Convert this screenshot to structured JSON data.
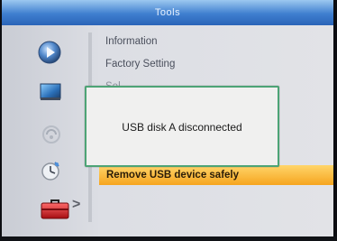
{
  "header": {
    "title": "Tools"
  },
  "menu": {
    "items": [
      {
        "label": "Information"
      },
      {
        "label": "Factory Setting"
      },
      {
        "label": "Sel"
      }
    ],
    "selected_label": "Remove USB device safely"
  },
  "dialog": {
    "message": "USB disk A disconnected"
  },
  "sidebar": {
    "icons": [
      {
        "name": "media-player-icon"
      },
      {
        "name": "picture-icon"
      },
      {
        "name": "network-icon"
      },
      {
        "name": "timer-icon"
      },
      {
        "name": "tools-toolbox-icon"
      }
    ],
    "arrow": ">"
  },
  "colors": {
    "title_bar": "#3f7fcf",
    "highlight": "#f6a51f",
    "dialog_border": "#4da476",
    "background": "#dcdee4"
  }
}
